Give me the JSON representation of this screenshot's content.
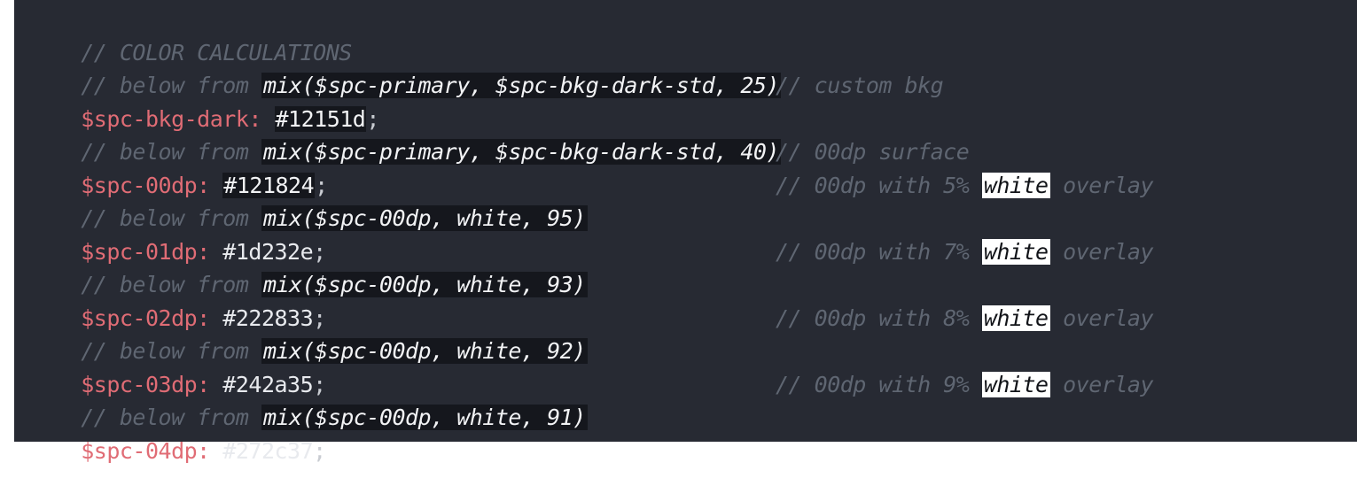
{
  "lines": [
    {
      "comment_prefix": "// COLOR CALCULATIONS"
    },
    {
      "comment_prefix": "// below from ",
      "expr": "mix($spc-primary, $spc-bkg-dark-std, 25)"
    },
    {
      "var": "$spc-bkg-dark:",
      "value": "#12151d",
      "semi": ";",
      "right_comment": "// custom bkg"
    },
    {
      "comment_prefix": "// below from ",
      "expr": "mix($spc-primary, $spc-bkg-dark-std, 40)"
    },
    {
      "var": "$spc-00dp:",
      "value": "#121824",
      "semi": ";",
      "right_comment": "// 00dp surface"
    },
    {
      "comment_prefix": "// below from ",
      "expr": "mix($spc-00dp, white, 95)",
      "right_prefix": "// 00dp with 5% ",
      "right_word": "white",
      "right_suffix": " overlay"
    },
    {
      "var": "$spc-01dp:",
      "value": "#1d232e",
      "semi": ";"
    },
    {
      "comment_prefix": "// below from ",
      "expr": "mix($spc-00dp, white, 93)",
      "right_prefix": "// 00dp with 7% ",
      "right_word": "white",
      "right_suffix": " overlay"
    },
    {
      "var": "$spc-02dp:",
      "value": "#222833",
      "semi": ";"
    },
    {
      "comment_prefix": "// below from ",
      "expr": "mix($spc-00dp, white, 92)",
      "right_prefix": "// 00dp with 8% ",
      "right_word": "white",
      "right_suffix": " overlay"
    },
    {
      "var": "$spc-03dp:",
      "value": "#242a35",
      "semi": ";"
    },
    {
      "comment_prefix": "// below from ",
      "expr": "mix($spc-00dp, white, 91)",
      "right_prefix": "// 00dp with 9% ",
      "right_word": "white",
      "right_suffix": " overlay"
    },
    {
      "var": "$spc-04dp:",
      "value": "#272c37",
      "semi": ";"
    }
  ]
}
